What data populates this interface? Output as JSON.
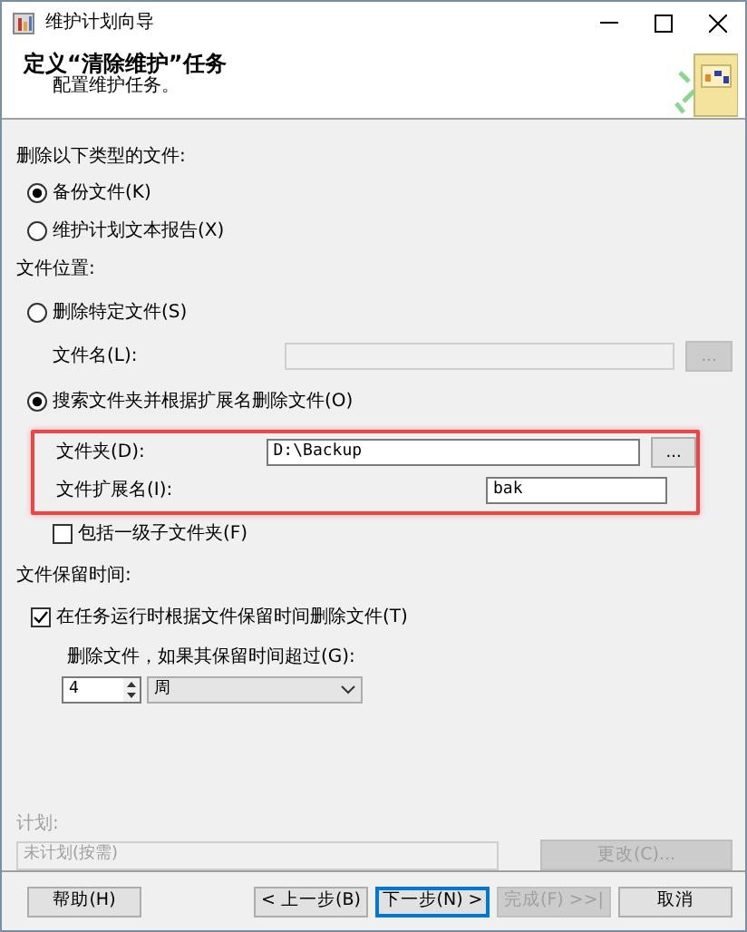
{
  "window": {
    "title": "维护计划向导"
  },
  "header": {
    "title": "定义“清除维护”任务",
    "subtitle": "配置维护任务。"
  },
  "file_types": {
    "label": "删除以下类型的文件:",
    "options": [
      {
        "label": "备份文件(K)",
        "selected": true
      },
      {
        "label": "维护计划文本报告(X)",
        "selected": false
      }
    ]
  },
  "file_location": {
    "label": "文件位置:",
    "options": [
      {
        "label": "删除特定文件(S)",
        "selected": false,
        "fields": [
          {
            "label": "文件名(L):",
            "disabled": true,
            "browse": "..."
          }
        ]
      },
      {
        "label": "搜索文件夹并根据扩展名删除文件(O)",
        "selected": true,
        "fields": [
          {
            "label": "文件夹(D):",
            "value": "D:\\Backup",
            "disabled": false,
            "browse": "..."
          },
          {
            "label": "文件扩展名(I):",
            "value": "bak",
            "disabled": false
          }
        ]
      }
    ]
  },
  "include_subfolders": {
    "label": "包括一级子文件夹(F)",
    "checked": false
  },
  "retention": {
    "label": "文件保留时间:",
    "checkbox": {
      "label": "在任务运行时根据文件保留时间删除文件(T)",
      "checked": true
    },
    "age_label": "删除文件，如果其保留时间超过(G):",
    "number": "4",
    "unit": "周"
  },
  "schedule": {
    "label": "计划:",
    "value": "未计划(按需)",
    "button": "更改(C)...",
    "disabled": true
  },
  "buttons": [
    {
      "label": "帮助(H)",
      "disabled": false,
      "default": false
    },
    {
      "label": "< 上一步(B)",
      "disabled": false,
      "default": false
    },
    {
      "label": "下一步(N) >",
      "disabled": false,
      "default": true
    },
    {
      "label": "完成(F) >>|",
      "disabled": true,
      "default": false
    },
    {
      "label": "取消",
      "disabled": false,
      "default": false
    }
  ]
}
